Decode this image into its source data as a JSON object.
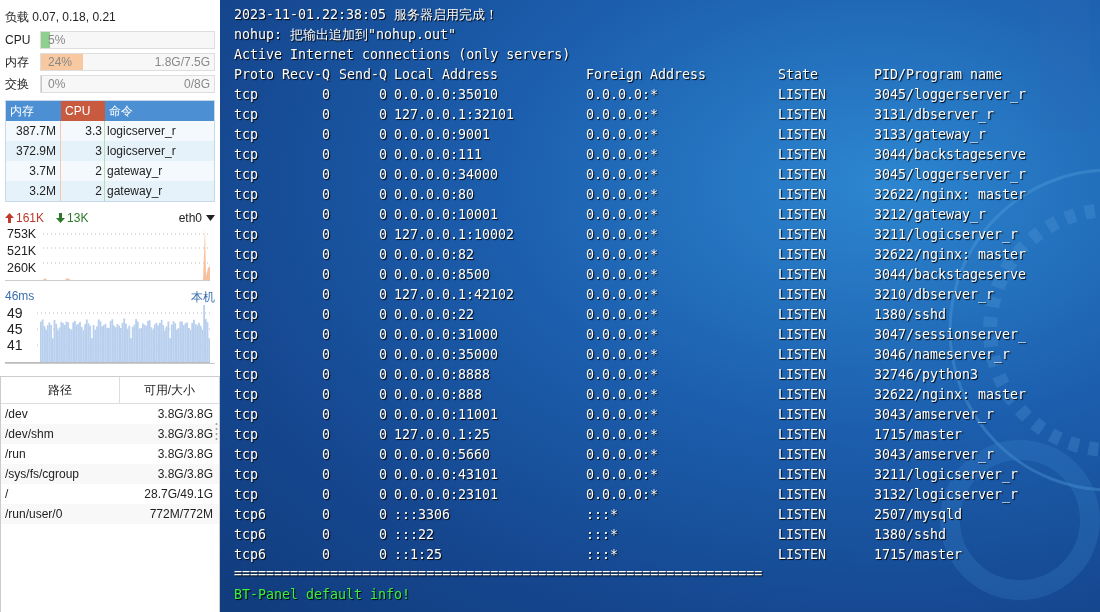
{
  "system": {
    "load": "负载 0.07, 0.18, 0.21"
  },
  "meters": [
    {
      "label": "CPU",
      "level": 0.05,
      "percent": "5%",
      "color": "#8fcf8f"
    },
    {
      "label": "内存",
      "level": 0.24,
      "percent": "24%",
      "reading": "1.8G/7.5G",
      "color": "#f8c9a0"
    },
    {
      "label": "交换",
      "level": 0,
      "percent": "0%",
      "reading": "0/8G"
    }
  ],
  "processes": {
    "columns": [
      {
        "label": "内存",
        "selected": false
      },
      {
        "label": "CPU",
        "selected": true
      },
      {
        "label": "命令",
        "selected": false
      }
    ],
    "rows": [
      [
        "387.7M",
        "3.3",
        "logicserver_r"
      ],
      [
        "372.9M",
        "3",
        "logicserver_r"
      ],
      [
        "3.7M",
        "2",
        "gateway_r"
      ],
      [
        "3.2M",
        "2",
        "gateway_r"
      ]
    ]
  },
  "network": {
    "upload": "161K",
    "download": "13K",
    "interface": "eth0",
    "y_labels": [
      "753K",
      "521K",
      "260K"
    ]
  },
  "ping": {
    "latency": "46ms",
    "target": "本机",
    "y_labels": [
      "49",
      "45",
      "41"
    ]
  },
  "disks": {
    "columns": [
      "路径",
      "可用/大小"
    ],
    "rows": [
      {
        "path": "/dev",
        "size": "3.8G/3.8G"
      },
      {
        "path": "/dev/shm",
        "size": "3.8G/3.8G"
      },
      {
        "path": "/run",
        "size": "3.8G/3.8G"
      },
      {
        "path": "/sys/fs/cgroup",
        "size": "3.8G/3.8G"
      },
      {
        "path": "/",
        "size": "28.7G/49.1G"
      },
      {
        "path": "/run/user/0",
        "size": "772M/772M"
      }
    ]
  },
  "terminal": {
    "lines": [
      "2023-11-01.22:38:05 服务器启用完成！",
      "nohup: 把输出追加到\"nohup.out\"",
      "Active Internet connections (only servers)"
    ],
    "columns": [
      "Proto",
      "Recv-Q",
      "Send-Q",
      "Local Address",
      "Foreign Address",
      "State",
      "PID/Program name"
    ],
    "rows": [
      [
        "tcp",
        "0",
        "0",
        "0.0.0.0:35010",
        "0.0.0.0:*",
        "LISTEN",
        "3045/loggerserver_r"
      ],
      [
        "tcp",
        "0",
        "0",
        "127.0.0.1:32101",
        "0.0.0.0:*",
        "LISTEN",
        "3131/dbserver_r"
      ],
      [
        "tcp",
        "0",
        "0",
        "0.0.0.0:9001",
        "0.0.0.0:*",
        "LISTEN",
        "3133/gateway_r"
      ],
      [
        "tcp",
        "0",
        "0",
        "0.0.0.0:111",
        "0.0.0.0:*",
        "LISTEN",
        "3044/backstageserve"
      ],
      [
        "tcp",
        "0",
        "0",
        "0.0.0.0:34000",
        "0.0.0.0:*",
        "LISTEN",
        "3045/loggerserver_r"
      ],
      [
        "tcp",
        "0",
        "0",
        "0.0.0.0:80",
        "0.0.0.0:*",
        "LISTEN",
        "32622/nginx: master"
      ],
      [
        "tcp",
        "0",
        "0",
        "0.0.0.0:10001",
        "0.0.0.0:*",
        "LISTEN",
        "3212/gateway_r"
      ],
      [
        "tcp",
        "0",
        "0",
        "127.0.0.1:10002",
        "0.0.0.0:*",
        "LISTEN",
        "3211/logicserver_r"
      ],
      [
        "tcp",
        "0",
        "0",
        "0.0.0.0:82",
        "0.0.0.0:*",
        "LISTEN",
        "32622/nginx: master"
      ],
      [
        "tcp",
        "0",
        "0",
        "0.0.0.0:8500",
        "0.0.0.0:*",
        "LISTEN",
        "3044/backstageserve"
      ],
      [
        "tcp",
        "0",
        "0",
        "127.0.0.1:42102",
        "0.0.0.0:*",
        "LISTEN",
        "3210/dbserver_r"
      ],
      [
        "tcp",
        "0",
        "0",
        "0.0.0.0:22",
        "0.0.0.0:*",
        "LISTEN",
        "1380/sshd"
      ],
      [
        "tcp",
        "0",
        "0",
        "0.0.0.0:31000",
        "0.0.0.0:*",
        "LISTEN",
        "3047/sessionserver_"
      ],
      [
        "tcp",
        "0",
        "0",
        "0.0.0.0:35000",
        "0.0.0.0:*",
        "LISTEN",
        "3046/nameserver_r"
      ],
      [
        "tcp",
        "0",
        "0",
        "0.0.0.0:8888",
        "0.0.0.0:*",
        "LISTEN",
        "32746/python3"
      ],
      [
        "tcp",
        "0",
        "0",
        "0.0.0.0:888",
        "0.0.0.0:*",
        "LISTEN",
        "32622/nginx: master"
      ],
      [
        "tcp",
        "0",
        "0",
        "0.0.0.0:11001",
        "0.0.0.0:*",
        "LISTEN",
        "3043/amserver_r"
      ],
      [
        "tcp",
        "0",
        "0",
        "127.0.0.1:25",
        "0.0.0.0:*",
        "LISTEN",
        "1715/master"
      ],
      [
        "tcp",
        "0",
        "0",
        "0.0.0.0:5660",
        "0.0.0.0:*",
        "LISTEN",
        "3043/amserver_r"
      ],
      [
        "tcp",
        "0",
        "0",
        "0.0.0.0:43101",
        "0.0.0.0:*",
        "LISTEN",
        "3211/logicserver_r"
      ],
      [
        "tcp",
        "0",
        "0",
        "0.0.0.0:23101",
        "0.0.0.0:*",
        "LISTEN",
        "3132/logicserver_r"
      ],
      [
        "tcp6",
        "0",
        "0",
        ":::3306",
        ":::*",
        "LISTEN",
        "2507/mysqld"
      ],
      [
        "tcp6",
        "0",
        "0",
        ":::22",
        ":::*",
        "LISTEN",
        "1380/sshd"
      ],
      [
        "tcp6",
        "0",
        "0",
        "::1:25",
        ":::*",
        "LISTEN",
        "1715/master"
      ]
    ],
    "separator": "==================================================================",
    "footer": "BT-Panel default info!"
  }
}
